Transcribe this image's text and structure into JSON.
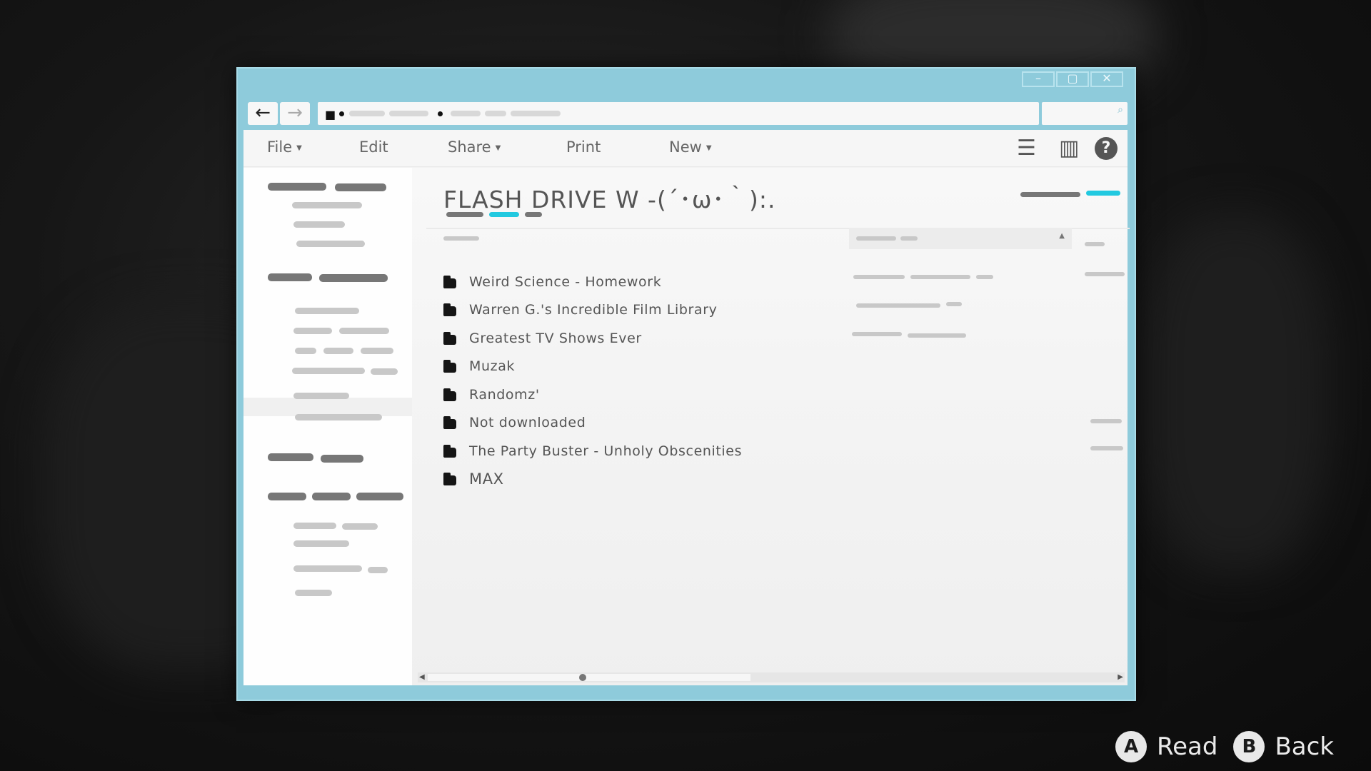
{
  "window": {
    "controls": [
      "–",
      "▢",
      "✕"
    ]
  },
  "nav": {
    "back_icon": "←",
    "forward_icon": "→"
  },
  "menu": {
    "file": "File",
    "edit": "Edit",
    "share": "Share",
    "print": "Print",
    "new": "New"
  },
  "toolbar": {
    "list_view_icon": "☰",
    "pane_icon": "▥",
    "help_icon": "?"
  },
  "page": {
    "title": "FLASH DRIVE W -(´･ω･｀):."
  },
  "files": [
    {
      "name": "Weird Science - Homework"
    },
    {
      "name": "Warren G.'s Incredible Film Library"
    },
    {
      "name": "Greatest TV Shows Ever"
    },
    {
      "name": "Muzak"
    },
    {
      "name": "Randomz'"
    },
    {
      "name": "Not downloaded"
    },
    {
      "name": "The Party Buster - Unholy Obscenities"
    },
    {
      "name": "MAX"
    }
  ],
  "hints": {
    "a_button": "A",
    "a_label": "Read",
    "b_button": "B",
    "b_label": "Back"
  },
  "colors": {
    "frame": "#8ecbdb",
    "accent": "#22c9e0",
    "background": "#111111"
  }
}
